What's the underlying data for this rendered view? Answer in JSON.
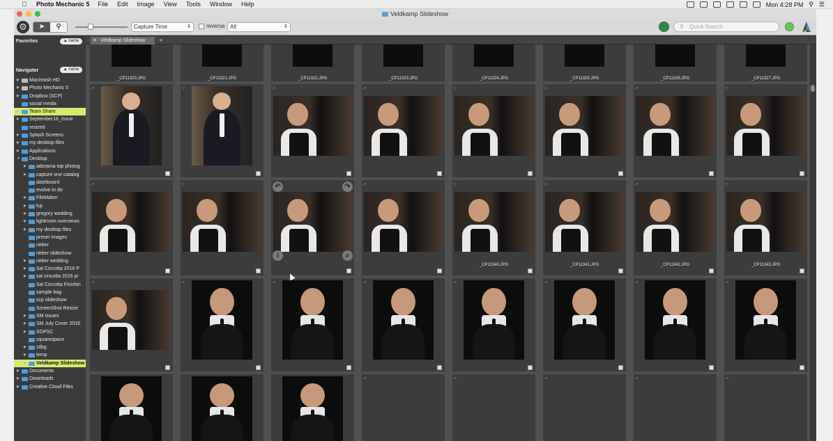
{
  "menubar": {
    "app_name": "Photo Mechanic 5",
    "items": [
      "File",
      "Edit",
      "Image",
      "View",
      "Tools",
      "Window",
      "Help"
    ],
    "clock": "Mon 4:28 PM"
  },
  "window": {
    "title": "Veldkamp Slideshow"
  },
  "toolbar": {
    "sort_value": "Capture Time",
    "reverse_label": "reverse",
    "filter_value": "All",
    "search_placeholder": "Quick Search"
  },
  "sidebar": {
    "favorites_label": "Favorites",
    "favorites_sort": "▲ name",
    "navigator_label": "Navigator",
    "navigator_sort": "▲ name",
    "items": [
      {
        "label": "Macintosh HD",
        "depth": 0,
        "type": "drive",
        "tri": "▶"
      },
      {
        "label": "Photo Mechanic 5",
        "depth": 0,
        "type": "drive",
        "tri": "▶"
      },
      {
        "label": "Dropbox (SCP)",
        "depth": 0,
        "type": "folder",
        "tri": "▶"
      },
      {
        "label": "social media",
        "depth": 0,
        "type": "folder",
        "tri": ""
      },
      {
        "label": "Team Share",
        "depth": 0,
        "type": "folder",
        "tri": "▶",
        "hl": "1"
      },
      {
        "label": "September16_Issue",
        "depth": 0,
        "type": "folder",
        "tri": "▶"
      },
      {
        "label": "resized",
        "depth": 0,
        "type": "folder",
        "tri": ""
      },
      {
        "label": "Splash Screens",
        "depth": 0,
        "type": "folder",
        "tri": "▶"
      },
      {
        "label": "my desktop files",
        "depth": 0,
        "type": "folder",
        "tri": "▶"
      },
      {
        "label": "Applications",
        "depth": 0,
        "type": "folder",
        "tri": "▶"
      },
      {
        "label": "Desktop",
        "depth": 0,
        "type": "folder",
        "tri": "▼"
      },
      {
        "label": "adorama top photog",
        "depth": 1,
        "type": "folder",
        "tri": "▶"
      },
      {
        "label": "capture one catalog",
        "depth": 1,
        "type": "folder",
        "tri": "▶"
      },
      {
        "label": "dashboard",
        "depth": 1,
        "type": "folder",
        "tri": ""
      },
      {
        "label": "evolve to do",
        "depth": 1,
        "type": "folder",
        "tri": ""
      },
      {
        "label": "FileMaker",
        "depth": 1,
        "type": "folder",
        "tri": "▶"
      },
      {
        "label": "fuji",
        "depth": 1,
        "type": "folder",
        "tri": "▶"
      },
      {
        "label": "gregory wedding",
        "depth": 1,
        "type": "folder",
        "tri": "▶"
      },
      {
        "label": "lightroom overviews",
        "depth": 1,
        "type": "folder",
        "tri": "▶"
      },
      {
        "label": "my desktop files",
        "depth": 1,
        "type": "folder",
        "tri": "▶"
      },
      {
        "label": "preset images",
        "depth": 1,
        "type": "folder",
        "tri": ""
      },
      {
        "label": "rieber",
        "depth": 1,
        "type": "folder",
        "tri": ""
      },
      {
        "label": "rieber slideshow",
        "depth": 1,
        "type": "folder",
        "tri": ""
      },
      {
        "label": "rieber wedding",
        "depth": 1,
        "type": "folder",
        "tri": "▶"
      },
      {
        "label": "Sal Cincotta 2016 P",
        "depth": 1,
        "type": "folder",
        "tri": "▶"
      },
      {
        "label": "sal cincotta 2016 pr",
        "depth": 1,
        "type": "folder",
        "tri": "▶"
      },
      {
        "label": "Sal Cincotta Finishin",
        "depth": 1,
        "type": "folder",
        "tri": ""
      },
      {
        "label": "sample bag",
        "depth": 1,
        "type": "folder",
        "tri": ""
      },
      {
        "label": "scp slideshow",
        "depth": 1,
        "type": "folder",
        "tri": ""
      },
      {
        "label": "ScreenShot Resize",
        "depth": 1,
        "type": "folder",
        "tri": ""
      },
      {
        "label": "SM Issues",
        "depth": 1,
        "type": "folder",
        "tri": "▶"
      },
      {
        "label": "SM July Cover 2016",
        "depth": 1,
        "type": "folder",
        "tri": "▶"
      },
      {
        "label": "SOPSC",
        "depth": 1,
        "type": "folder",
        "tri": "▶"
      },
      {
        "label": "squarespace",
        "depth": 1,
        "type": "folder",
        "tri": ""
      },
      {
        "label": "stlbg",
        "depth": 1,
        "type": "folder",
        "tri": "▶"
      },
      {
        "label": "temp",
        "depth": 1,
        "type": "folder",
        "tri": "▶"
      },
      {
        "label": "Veldkamp Slideshow",
        "depth": 1,
        "type": "folder",
        "tri": "▶",
        "hl": "2"
      },
      {
        "label": "Documents",
        "depth": 0,
        "type": "folder",
        "tri": "▶"
      },
      {
        "label": "Downloads",
        "depth": 0,
        "type": "folder",
        "tri": "▶"
      },
      {
        "label": "Creative Cloud Files",
        "depth": 0,
        "type": "folder",
        "tri": "▶"
      }
    ]
  },
  "tab": {
    "close": "✕",
    "label": "Veldkamp Slideshow",
    "add": "+"
  },
  "thumbs": {
    "row0": [
      "_CP11320.JPG",
      "_CP11321.JPG",
      "_CP11322.JPG",
      "_CP11323.JPG",
      "_CP11324.JPG",
      "_CP11325.JPG",
      "_CP11326.JPG",
      "_CP11327.JPG"
    ],
    "row2": [
      "",
      "",
      "",
      "",
      "_CP11340.JPG",
      "_CP11341.JPG",
      "_CP11342.JPG",
      "_CP11343.JPG"
    ]
  },
  "icon_names": [
    "apple-icon",
    "gear-icon",
    "pointer-tool-icon",
    "zoom-tool-icon",
    "globe-icon",
    "search-icon",
    "folder-icon",
    "drive-icon",
    "rotate-left-icon",
    "rotate-right-icon",
    "info-icon",
    "magnify-icon"
  ],
  "colors": {
    "accent_highlight": "#d3ec6e",
    "label_red": "#e23a2a",
    "folder_blue": "#4b9fe0"
  }
}
